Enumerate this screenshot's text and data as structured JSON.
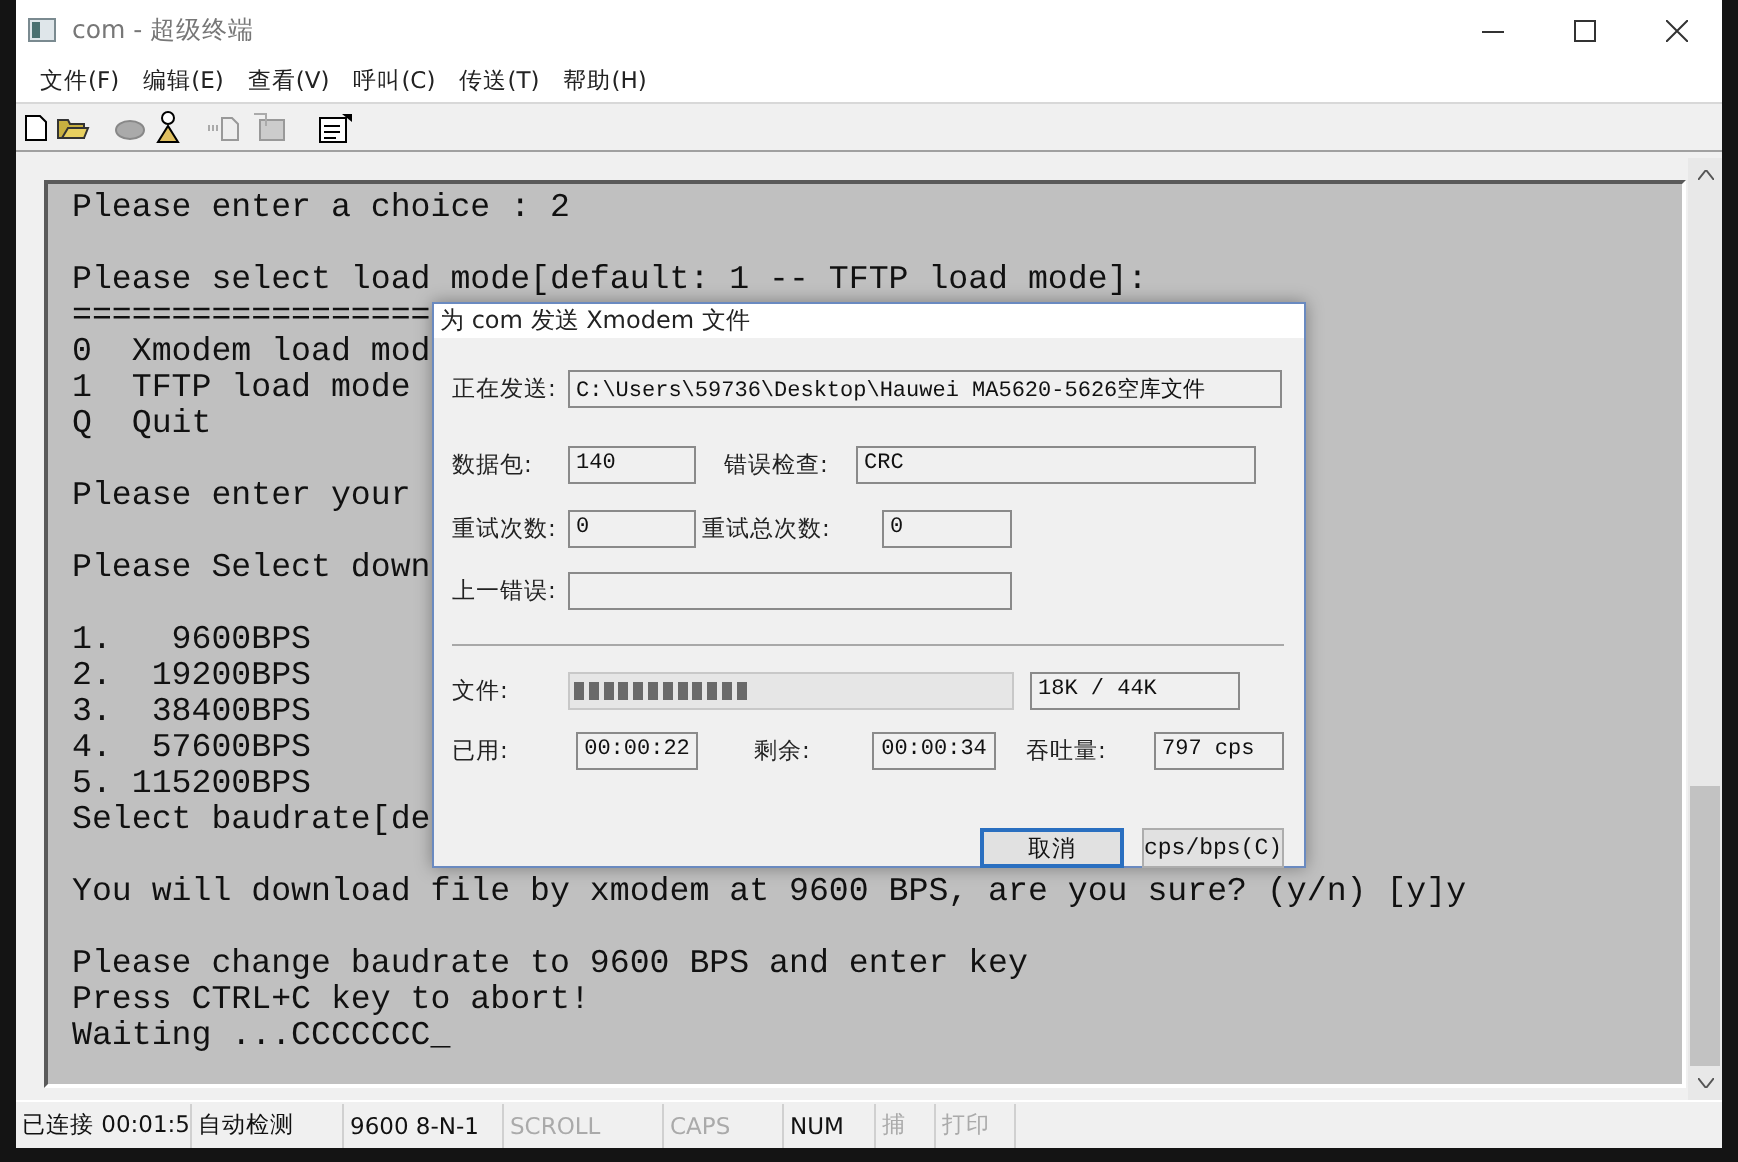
{
  "window": {
    "title": "com - 超级终端"
  },
  "menu": [
    "文件(F)",
    "编辑(E)",
    "查看(V)",
    "呼叫(C)",
    "传送(T)",
    "帮助(H)"
  ],
  "terminal": {
    "blocks": [
      [
        "Please enter a choice : 2"
      ],
      [
        "Please select load mode[default: 1 -- TFTP load mode]:",
        "==================",
        "0  Xmodem load mod",
        "1  TFTP load mode",
        "Q  Quit"
      ],
      [
        "Please enter your"
      ],
      [
        "Please Select down"
      ],
      [
        "1.   9600BPS",
        "2.  19200BPS",
        "3.  38400BPS",
        "4.  57600BPS",
        "5. 115200BPS",
        "Select baudrate[de"
      ],
      [
        "You will download file by xmodem at 9600 BPS, are you sure? (y/n) [y]y"
      ],
      [
        "Please change baudrate to 9600 BPS and enter key",
        "Press CTRL+C key to abort!",
        "Waiting ...CCCCCCC_"
      ]
    ]
  },
  "dialog": {
    "title": "为 com 发送 Xmodem 文件",
    "sending": {
      "label": "正在发送:",
      "value": "C:\\Users\\59736\\Desktop\\Hauwei MA5620-5626空库文件"
    },
    "packets": {
      "label": "数据包:",
      "value": "140"
    },
    "error_check": {
      "label": "错误检查:",
      "value": "CRC"
    },
    "retries": {
      "label": "重试次数:",
      "value": "0"
    },
    "total_retries": {
      "label": "重试总次数:",
      "value": "0"
    },
    "last_error": {
      "label": "上一错误:"
    },
    "file": {
      "label": "文件:",
      "level": 0.41,
      "size": "18K / 44K"
    },
    "elapsed": {
      "label": "已用:",
      "value": "00:00:22"
    },
    "remaining": {
      "label": "剩余:",
      "value": "00:00:34"
    },
    "throughput": {
      "label": "吞吐量:",
      "value": "797 cps"
    },
    "buttons": [
      {
        "label": "取消",
        "default": true
      },
      {
        "label": "cps/bps(C)",
        "default": false
      }
    ]
  },
  "status_bar": [
    {
      "text": "已连接 00:01:5",
      "active": true
    },
    {
      "text": "自动检测",
      "active": true
    },
    {
      "text": "9600 8-N-1",
      "active": true
    },
    {
      "text": "SCROLL",
      "active": false
    },
    {
      "text": "CAPS",
      "active": false
    },
    {
      "text": "NUM",
      "active": true
    },
    {
      "text": "捕",
      "active": false
    },
    {
      "text": "打印",
      "active": false
    }
  ]
}
